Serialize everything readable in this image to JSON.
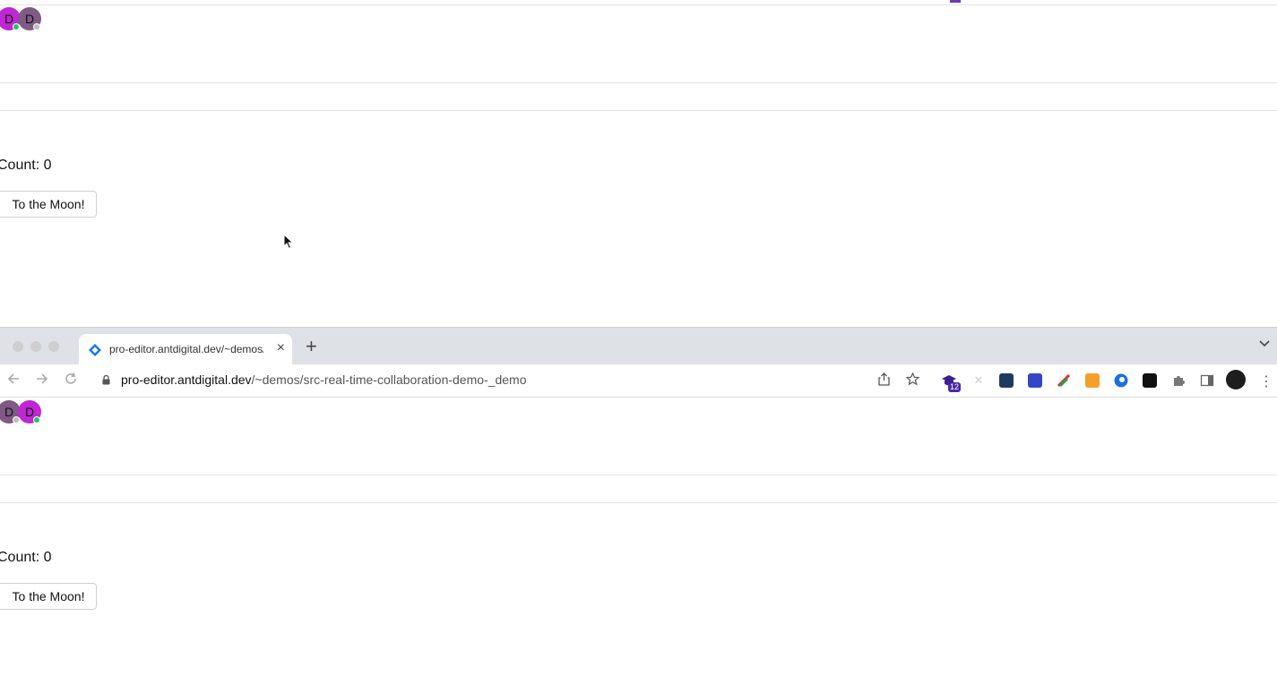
{
  "top_pane": {
    "avatars": [
      {
        "initial": "D",
        "color": "#c026d3",
        "status": "online",
        "status_color": "#22c55e"
      },
      {
        "initial": "D",
        "color": "#7e5a84",
        "status": "away",
        "status_color": "#bdbdbd"
      }
    ],
    "count_text": "Count: 0",
    "button_label": "To the Moon!"
  },
  "browser": {
    "tab_title": "pro-editor.antdigital.dev/~demos/src-real-time-collaboration-demo-_demo",
    "url_host": "pro-editor.antdigital.dev",
    "url_path": "/~demos/src-real-time-collaboration-demo-_demo",
    "extension_badge": "12"
  },
  "bottom_pane": {
    "avatars": [
      {
        "initial": "D",
        "color": "#7e5a84",
        "status": "away",
        "status_color": "#bdbdbd"
      },
      {
        "initial": "D",
        "color": "#c026d3",
        "status": "online",
        "status_color": "#22c55e"
      }
    ],
    "count_text": "Count: 0",
    "button_label": "To the Moon!"
  }
}
